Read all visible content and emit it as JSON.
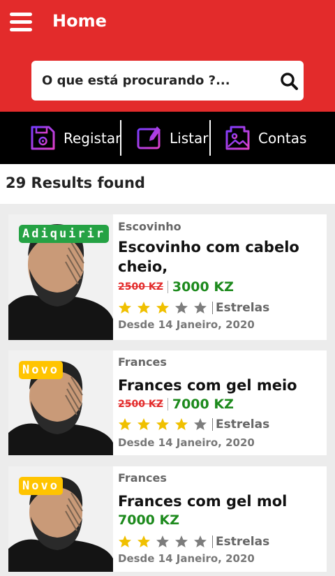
{
  "header": {
    "title": "Home",
    "menu_icon": "hamburger-menu-icon",
    "bg_color": "#e32b2b"
  },
  "search": {
    "placeholder": "O que está procurando ?...",
    "icon": "search-icon"
  },
  "nav": {
    "items": [
      {
        "label": "Registar",
        "icon": "save-disk-icon"
      },
      {
        "label": "Listar",
        "icon": "list-icon"
      },
      {
        "label": "Contas",
        "icon": "accounts-image-icon"
      }
    ]
  },
  "results": {
    "text": "29 Results found"
  },
  "listings": [
    {
      "badge": "Adiquirir",
      "badge_color": "#25a244",
      "category": "Escovinho",
      "name": "Escovinho com cabelo cheio,",
      "old_price": "2500 KZ",
      "price": "3000 KZ",
      "rating": 3,
      "rating_max": 5,
      "rating_label": "Estrelas",
      "date": "Desde 14 Janeiro, 2020"
    },
    {
      "badge": "Novo",
      "badge_color": "#ffc400",
      "category": "Frances",
      "name": "Frances com gel meio",
      "old_price": "2500 KZ",
      "price": "7000 KZ",
      "rating": 4,
      "rating_max": 5,
      "rating_label": "Estrelas",
      "date": "Desde 14 Janeiro, 2020"
    },
    {
      "badge": "Novo",
      "badge_color": "#ffc400",
      "category": "Frances",
      "name": "Frances com gel mol",
      "price": "7000 KZ",
      "rating": 2,
      "rating_max": 5,
      "rating_label": "Estrelas",
      "date": "Desde 14 Janeiro, 2020"
    }
  ]
}
